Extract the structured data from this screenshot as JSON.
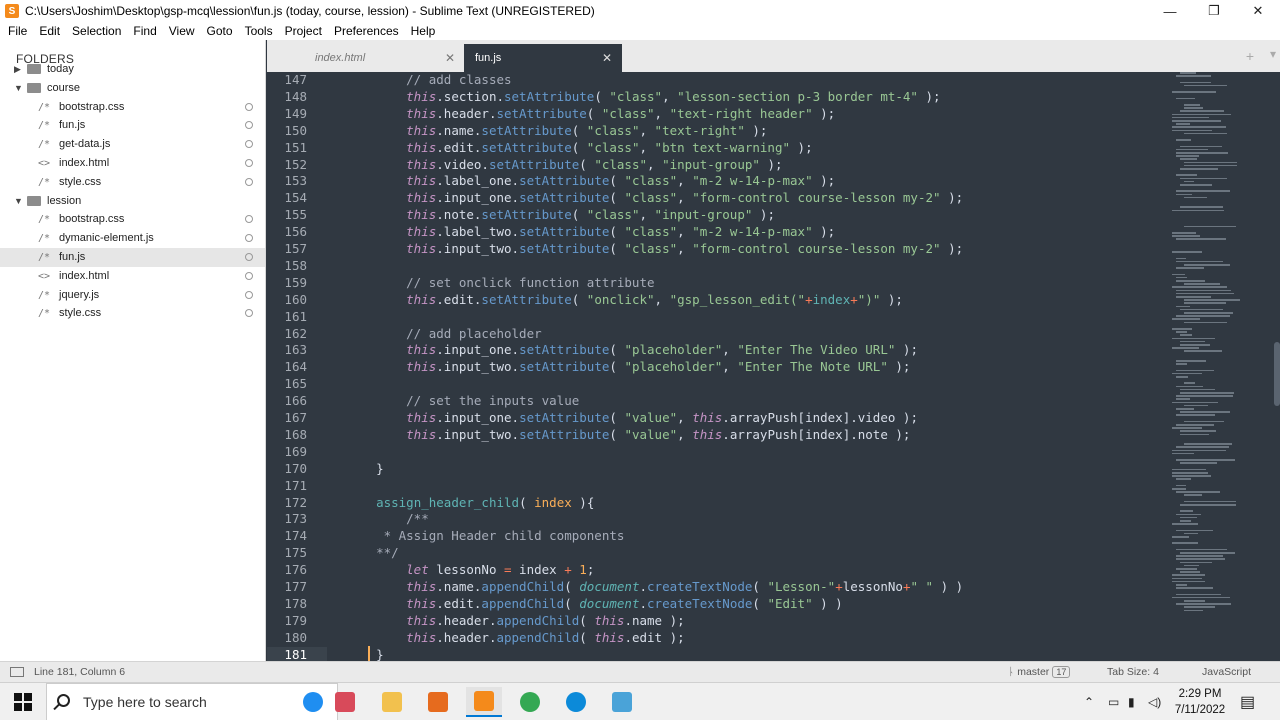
{
  "window": {
    "title": "C:\\Users\\Joshim\\Desktop\\gsp-mcq\\lession\\fun.js (today, course, lession) - Sublime Text (UNREGISTERED)",
    "app_icon_letter": "S",
    "minimize_glyph": "—",
    "maximize_glyph": "❐",
    "close_glyph": "✕"
  },
  "menu": [
    "File",
    "Edit",
    "Selection",
    "Find",
    "View",
    "Goto",
    "Tools",
    "Project",
    "Preferences",
    "Help"
  ],
  "sidebar": {
    "header": "FOLDERS",
    "items": [
      {
        "type": "folder",
        "label": "today",
        "level": 0,
        "expanded": false
      },
      {
        "type": "folder",
        "label": "course",
        "level": 0,
        "expanded": true
      },
      {
        "type": "file",
        "label": "bootstrap.css",
        "level": 1,
        "icon": "/*"
      },
      {
        "type": "file",
        "label": "fun.js",
        "level": 1,
        "icon": "/*"
      },
      {
        "type": "file",
        "label": "get-data.js",
        "level": 1,
        "icon": "/*"
      },
      {
        "type": "file",
        "label": "index.html",
        "level": 1,
        "icon": "<>"
      },
      {
        "type": "file",
        "label": "style.css",
        "level": 1,
        "icon": "/*"
      },
      {
        "type": "folder",
        "label": "lession",
        "level": 0,
        "expanded": true
      },
      {
        "type": "file",
        "label": "bootstrap.css",
        "level": 1,
        "icon": "/*"
      },
      {
        "type": "file",
        "label": "dymanic-element.js",
        "level": 1,
        "icon": "/*"
      },
      {
        "type": "file",
        "label": "fun.js",
        "level": 1,
        "icon": "/*",
        "selected": true
      },
      {
        "type": "file",
        "label": "index.html",
        "level": 1,
        "icon": "<>"
      },
      {
        "type": "file",
        "label": "jquery.js",
        "level": 1,
        "icon": "/*"
      },
      {
        "type": "file",
        "label": "style.css",
        "level": 1,
        "icon": "/*"
      }
    ]
  },
  "tabs": [
    {
      "label": "index.html",
      "active": false
    },
    {
      "label": "fun.js",
      "active": true
    }
  ],
  "tab_bar": {
    "nav_arrows": "◀ ▶",
    "plus": "+",
    "list": "▾"
  },
  "editor": {
    "current_line": 181,
    "lines": [
      {
        "n": 147,
        "tokens": [
          [
            "      ",
            ""
          ],
          [
            "// add classes",
            "cm"
          ]
        ]
      },
      {
        "n": 148,
        "tokens": [
          [
            "      ",
            ""
          ],
          [
            "this",
            "kw"
          ],
          [
            ".section.",
            ""
          ],
          [
            "setAttribute",
            "fn"
          ],
          [
            "( ",
            ""
          ],
          [
            "\"class\"",
            "str"
          ],
          [
            ", ",
            ""
          ],
          [
            "\"lesson-section p-3 border mt-4\"",
            "str"
          ],
          [
            " );",
            ""
          ]
        ]
      },
      {
        "n": 149,
        "tokens": [
          [
            "      ",
            ""
          ],
          [
            "this",
            "kw"
          ],
          [
            ".header.",
            ""
          ],
          [
            "setAttribute",
            "fn"
          ],
          [
            "( ",
            ""
          ],
          [
            "\"class\"",
            "str"
          ],
          [
            ", ",
            ""
          ],
          [
            "\"text-right header\"",
            "str"
          ],
          [
            " );",
            ""
          ]
        ]
      },
      {
        "n": 150,
        "tokens": [
          [
            "      ",
            ""
          ],
          [
            "this",
            "kw"
          ],
          [
            ".name.",
            ""
          ],
          [
            "setAttribute",
            "fn"
          ],
          [
            "( ",
            ""
          ],
          [
            "\"class\"",
            "str"
          ],
          [
            ", ",
            ""
          ],
          [
            "\"text-right\"",
            "str"
          ],
          [
            " );",
            ""
          ]
        ]
      },
      {
        "n": 151,
        "tokens": [
          [
            "      ",
            ""
          ],
          [
            "this",
            "kw"
          ],
          [
            ".edit.",
            ""
          ],
          [
            "setAttribute",
            "fn"
          ],
          [
            "( ",
            ""
          ],
          [
            "\"class\"",
            "str"
          ],
          [
            ", ",
            ""
          ],
          [
            "\"btn text-warning\"",
            "str"
          ],
          [
            " );",
            ""
          ]
        ]
      },
      {
        "n": 152,
        "tokens": [
          [
            "      ",
            ""
          ],
          [
            "this",
            "kw"
          ],
          [
            ".video.",
            ""
          ],
          [
            "setAttribute",
            "fn"
          ],
          [
            "( ",
            ""
          ],
          [
            "\"class\"",
            "str"
          ],
          [
            ", ",
            ""
          ],
          [
            "\"input-group\"",
            "str"
          ],
          [
            " );",
            ""
          ]
        ]
      },
      {
        "n": 153,
        "tokens": [
          [
            "      ",
            ""
          ],
          [
            "this",
            "kw"
          ],
          [
            ".label_one.",
            ""
          ],
          [
            "setAttribute",
            "fn"
          ],
          [
            "( ",
            ""
          ],
          [
            "\"class\"",
            "str"
          ],
          [
            ", ",
            ""
          ],
          [
            "\"m-2 w-14-p-max\"",
            "str"
          ],
          [
            " );",
            ""
          ]
        ]
      },
      {
        "n": 154,
        "tokens": [
          [
            "      ",
            ""
          ],
          [
            "this",
            "kw"
          ],
          [
            ".input_one.",
            ""
          ],
          [
            "setAttribute",
            "fn"
          ],
          [
            "( ",
            ""
          ],
          [
            "\"class\"",
            "str"
          ],
          [
            ", ",
            ""
          ],
          [
            "\"form-control course-lesson my-2\"",
            "str"
          ],
          [
            " );",
            ""
          ]
        ]
      },
      {
        "n": 155,
        "tokens": [
          [
            "      ",
            ""
          ],
          [
            "this",
            "kw"
          ],
          [
            ".note.",
            ""
          ],
          [
            "setAttribute",
            "fn"
          ],
          [
            "( ",
            ""
          ],
          [
            "\"class\"",
            "str"
          ],
          [
            ", ",
            ""
          ],
          [
            "\"input-group\"",
            "str"
          ],
          [
            " );",
            ""
          ]
        ]
      },
      {
        "n": 156,
        "tokens": [
          [
            "      ",
            ""
          ],
          [
            "this",
            "kw"
          ],
          [
            ".label_two.",
            ""
          ],
          [
            "setAttribute",
            "fn"
          ],
          [
            "( ",
            ""
          ],
          [
            "\"class\"",
            "str"
          ],
          [
            ", ",
            ""
          ],
          [
            "\"m-2 w-14-p-max\"",
            "str"
          ],
          [
            " );",
            ""
          ]
        ]
      },
      {
        "n": 157,
        "tokens": [
          [
            "      ",
            ""
          ],
          [
            "this",
            "kw"
          ],
          [
            ".input_two.",
            ""
          ],
          [
            "setAttribute",
            "fn"
          ],
          [
            "( ",
            ""
          ],
          [
            "\"class\"",
            "str"
          ],
          [
            ", ",
            ""
          ],
          [
            "\"form-control course-lesson my-2\"",
            "str"
          ],
          [
            " );",
            ""
          ]
        ]
      },
      {
        "n": 158,
        "tokens": []
      },
      {
        "n": 159,
        "tokens": [
          [
            "      ",
            ""
          ],
          [
            "// set onclick function attribute",
            "cm"
          ]
        ]
      },
      {
        "n": 160,
        "tokens": [
          [
            "      ",
            ""
          ],
          [
            "this",
            "kw"
          ],
          [
            ".edit.",
            ""
          ],
          [
            "setAttribute",
            "fn"
          ],
          [
            "( ",
            ""
          ],
          [
            "\"onclick\"",
            "str"
          ],
          [
            ", ",
            ""
          ],
          [
            "\"gsp_lesson_edit(\"",
            "str"
          ],
          [
            "+",
            "op"
          ],
          [
            "index",
            "def"
          ],
          [
            "+",
            "op"
          ],
          [
            "\")\"",
            "str"
          ],
          [
            " );",
            ""
          ]
        ]
      },
      {
        "n": 161,
        "tokens": []
      },
      {
        "n": 162,
        "tokens": [
          [
            "      ",
            ""
          ],
          [
            "// add placeholder",
            "cm"
          ]
        ]
      },
      {
        "n": 163,
        "tokens": [
          [
            "      ",
            ""
          ],
          [
            "this",
            "kw"
          ],
          [
            ".input_one.",
            ""
          ],
          [
            "setAttribute",
            "fn"
          ],
          [
            "( ",
            ""
          ],
          [
            "\"placeholder\"",
            "str"
          ],
          [
            ", ",
            ""
          ],
          [
            "\"Enter The Video URL\"",
            "str"
          ],
          [
            " );",
            ""
          ]
        ]
      },
      {
        "n": 164,
        "tokens": [
          [
            "      ",
            ""
          ],
          [
            "this",
            "kw"
          ],
          [
            ".input_two.",
            ""
          ],
          [
            "setAttribute",
            "fn"
          ],
          [
            "( ",
            ""
          ],
          [
            "\"placeholder\"",
            "str"
          ],
          [
            ", ",
            ""
          ],
          [
            "\"Enter The Note URL\"",
            "str"
          ],
          [
            " );",
            ""
          ]
        ]
      },
      {
        "n": 165,
        "tokens": []
      },
      {
        "n": 166,
        "tokens": [
          [
            "      ",
            ""
          ],
          [
            "// set the inputs value",
            "cm"
          ]
        ]
      },
      {
        "n": 167,
        "tokens": [
          [
            "      ",
            ""
          ],
          [
            "this",
            "kw"
          ],
          [
            ".input_one.",
            ""
          ],
          [
            "setAttribute",
            "fn"
          ],
          [
            "( ",
            ""
          ],
          [
            "\"value\"",
            "str"
          ],
          [
            ", ",
            ""
          ],
          [
            "this",
            "kw"
          ],
          [
            ".arrayPush[index].video );",
            ""
          ]
        ]
      },
      {
        "n": 168,
        "tokens": [
          [
            "      ",
            ""
          ],
          [
            "this",
            "kw"
          ],
          [
            ".input_two.",
            ""
          ],
          [
            "setAttribute",
            "fn"
          ],
          [
            "( ",
            ""
          ],
          [
            "\"value\"",
            "str"
          ],
          [
            ", ",
            ""
          ],
          [
            "this",
            "kw"
          ],
          [
            ".arrayPush[index].note );",
            ""
          ]
        ]
      },
      {
        "n": 169,
        "tokens": []
      },
      {
        "n": 170,
        "tokens": [
          [
            "  ",
            ""
          ],
          [
            "}",
            "brace"
          ]
        ]
      },
      {
        "n": 171,
        "tokens": []
      },
      {
        "n": 172,
        "tokens": [
          [
            "  ",
            ""
          ],
          [
            "assign_header_child",
            "def"
          ],
          [
            "( ",
            ""
          ],
          [
            "index",
            "var"
          ],
          [
            " ){",
            ""
          ]
        ]
      },
      {
        "n": 173,
        "tokens": [
          [
            "      ",
            ""
          ],
          [
            "/**",
            "cm"
          ]
        ]
      },
      {
        "n": 174,
        "tokens": [
          [
            "   ",
            ""
          ],
          [
            "* Assign Header child components",
            "cm"
          ]
        ]
      },
      {
        "n": 175,
        "tokens": [
          [
            "  ",
            ""
          ],
          [
            "**/",
            "cm"
          ]
        ]
      },
      {
        "n": 176,
        "tokens": [
          [
            "      ",
            ""
          ],
          [
            "let",
            "kw"
          ],
          [
            " lessonNo ",
            ""
          ],
          [
            "=",
            "op"
          ],
          [
            " index ",
            ""
          ],
          [
            "+",
            "op"
          ],
          [
            " ",
            ""
          ],
          [
            "1",
            "num"
          ],
          [
            ";",
            ""
          ]
        ]
      },
      {
        "n": 177,
        "tokens": [
          [
            "      ",
            ""
          ],
          [
            "this",
            "kw"
          ],
          [
            ".name.",
            ""
          ],
          [
            "appendChild",
            "fn"
          ],
          [
            "( ",
            ""
          ],
          [
            "document",
            "obj"
          ],
          [
            ".",
            ""
          ],
          [
            "createTextNode",
            "fn"
          ],
          [
            "( ",
            ""
          ],
          [
            "\"Lesson-\"",
            "str"
          ],
          [
            "+",
            "op"
          ],
          [
            "lessonNo",
            ""
          ],
          [
            "+",
            "op"
          ],
          [
            "\" \"",
            "str"
          ],
          [
            " ) )",
            ""
          ]
        ]
      },
      {
        "n": 178,
        "tokens": [
          [
            "      ",
            ""
          ],
          [
            "this",
            "kw"
          ],
          [
            ".edit.",
            ""
          ],
          [
            "appendChild",
            "fn"
          ],
          [
            "( ",
            ""
          ],
          [
            "document",
            "obj"
          ],
          [
            ".",
            ""
          ],
          [
            "createTextNode",
            "fn"
          ],
          [
            "( ",
            ""
          ],
          [
            "\"Edit\"",
            "str"
          ],
          [
            " ) )",
            ""
          ]
        ]
      },
      {
        "n": 179,
        "tokens": [
          [
            "      ",
            ""
          ],
          [
            "this",
            "kw"
          ],
          [
            ".header.",
            ""
          ],
          [
            "appendChild",
            "fn"
          ],
          [
            "( ",
            ""
          ],
          [
            "this",
            "kw"
          ],
          [
            ".name );",
            ""
          ]
        ]
      },
      {
        "n": 180,
        "tokens": [
          [
            "      ",
            ""
          ],
          [
            "this",
            "kw"
          ],
          [
            ".header.",
            ""
          ],
          [
            "appendChild",
            "fn"
          ],
          [
            "( ",
            ""
          ],
          [
            "this",
            "kw"
          ],
          [
            ".edit );",
            ""
          ]
        ]
      },
      {
        "n": 181,
        "tokens": [
          [
            "  ",
            ""
          ],
          [
            "}",
            "brace"
          ]
        ]
      }
    ]
  },
  "status": {
    "position": "Line 181, Column 6",
    "branch": "master",
    "branch_badge": "17",
    "tab_size": "Tab Size: 4",
    "syntax": "JavaScript"
  },
  "taskbar": {
    "search_placeholder": "Type here to search",
    "time": "2:29 PM",
    "date": "7/11/2022",
    "tray_icons": [
      "chevron-up-icon",
      "network-icon",
      "battery-icon",
      "volume-icon"
    ],
    "apps": [
      {
        "name": "edge-icon",
        "color": "#1f8ef1"
      },
      {
        "name": "chart-app-icon",
        "color": "#d84a5a"
      },
      {
        "name": "file-explorer-icon",
        "color": "#f2c14e"
      },
      {
        "name": "app-icon-orange",
        "color": "#e66b1e"
      },
      {
        "name": "sublime-text-icon",
        "color": "#f48a1b"
      },
      {
        "name": "chrome-icon",
        "color": "#34a853"
      },
      {
        "name": "edge-new-icon",
        "color": "#0c8ad9"
      },
      {
        "name": "app-icon-blue",
        "color": "#4aa3d8"
      }
    ]
  }
}
